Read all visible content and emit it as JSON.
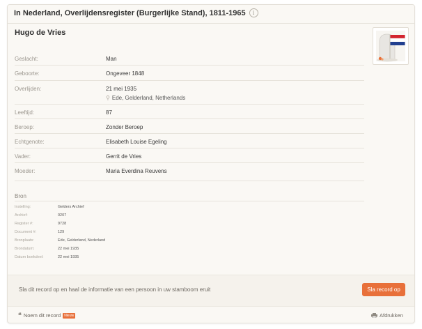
{
  "header": {
    "title": "In Nederland, Overlijdensregister (Burgerlijke Stand), 1811-1965",
    "info_glyph": "i"
  },
  "person": {
    "name": "Hugo de Vries"
  },
  "portrait": {
    "icon": "gravestone-with-dutch-flag-icon",
    "flag_colors": [
      "#d3242e",
      "#ffffff",
      "#213f8f"
    ]
  },
  "fields": [
    {
      "label": "Geslacht:",
      "value": "Man"
    },
    {
      "label": "Geboorte:",
      "value": "Ongeveer 1848"
    },
    {
      "label": "Overlijden:",
      "value": "21 mei 1935",
      "place": "Ede, Gelderland, Netherlands"
    },
    {
      "label": "Leeftijd:",
      "value": "87"
    },
    {
      "label": "Beroep:",
      "value": "Zonder Beroep"
    },
    {
      "label": "Echtgenote:",
      "value": "Elisabeth Louise Egeling"
    },
    {
      "label": "Vader:",
      "value": "Gerrit de Vries"
    },
    {
      "label": "Moeder:",
      "value": "Maria Everdina Reuvens"
    }
  ],
  "source": {
    "title": "Bron",
    "items": [
      {
        "label": "Instelling:",
        "value": "Gelders Archief"
      },
      {
        "label": "Archief:",
        "value": "0207"
      },
      {
        "label": "Register #:",
        "value": "9728"
      },
      {
        "label": "Document #:",
        "value": "129"
      },
      {
        "label": "Bronplaats:",
        "value": "Ede, Gelderland, Nederland"
      },
      {
        "label": "Brondatum:",
        "value": "22 mei 1935"
      },
      {
        "label": "Datum boekdeel:",
        "value": "22 mei 1935"
      }
    ]
  },
  "save": {
    "text": "Sla dit record op en haal de informatie van een persoon in uw stamboom eruit",
    "button": "Sla record op"
  },
  "footer": {
    "cite_label": "Noem dit record",
    "badge": "Nieuw",
    "print_label": "Afdrukken"
  },
  "colors": {
    "accent": "#e8703a",
    "card_bg": "#faf8f4"
  }
}
